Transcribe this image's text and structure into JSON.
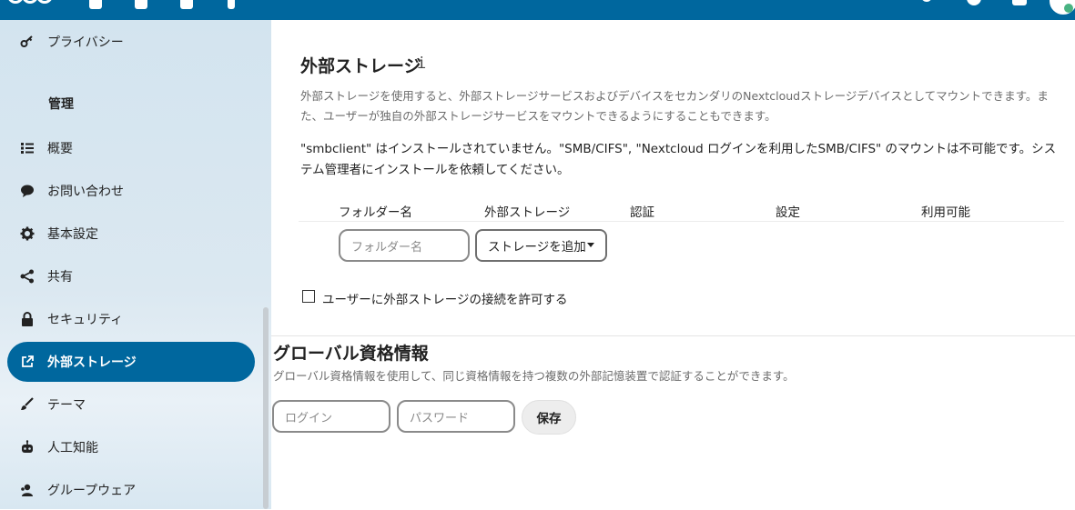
{
  "sidebar": {
    "items": [
      {
        "label": "プライバシー",
        "icon": "key-icon"
      },
      {
        "label": "概要",
        "icon": "list-icon"
      },
      {
        "label": "お問い合わせ",
        "icon": "chat-bubble-icon"
      },
      {
        "label": "基本設定",
        "icon": "gear-icon"
      },
      {
        "label": "共有",
        "icon": "share-icon"
      },
      {
        "label": "セキュリティ",
        "icon": "lock-icon"
      },
      {
        "label": "外部ストレージ",
        "icon": "external-link-icon"
      },
      {
        "label": "テーマ",
        "icon": "brush-icon"
      },
      {
        "label": "人工知能",
        "icon": "robot-icon"
      },
      {
        "label": "グループウェア",
        "icon": "groupware-icon"
      }
    ],
    "section_caption": "管理"
  },
  "main": {
    "title": "外部ストレージ",
    "info_icon_glyph": "i",
    "description": "外部ストレージを使用すると、外部ストレージサービスおよびデバイスをセカンダリのNextcloudストレージデバイスとしてマウントできます。また、ユーザーが独自の外部ストレージサービスをマウントできるようにすることもできます。",
    "warning": "\"smbclient\" はインストールされていません。\"SMB/CIFS\", \"Nextcloud ログインを利用したSMB/CIFS\" のマウントは不可能です。システム管理者にインストールを依頼してください。",
    "table_headers": [
      "フォルダー名",
      "外部ストレージ",
      "認証",
      "設定",
      "利用可能"
    ],
    "folder_name_placeholder": "フォルダー名",
    "add_storage_label": "ストレージを追加",
    "allow_user_mount_label": "ユーザーに外部ストレージの接続を許可する",
    "allow_user_mount_checked": false
  },
  "global_credentials": {
    "title": "グローバル資格情報",
    "description": "グローバル資格情報を使用して、同じ資格情報を持つ複数の外部記憶装置で認証することができます。",
    "login_placeholder": "ログイン",
    "password_placeholder": "パスワード",
    "save_label": "保存"
  },
  "colors": {
    "accent": "#00679e",
    "sidebar_bg": "#d6e6f1"
  }
}
